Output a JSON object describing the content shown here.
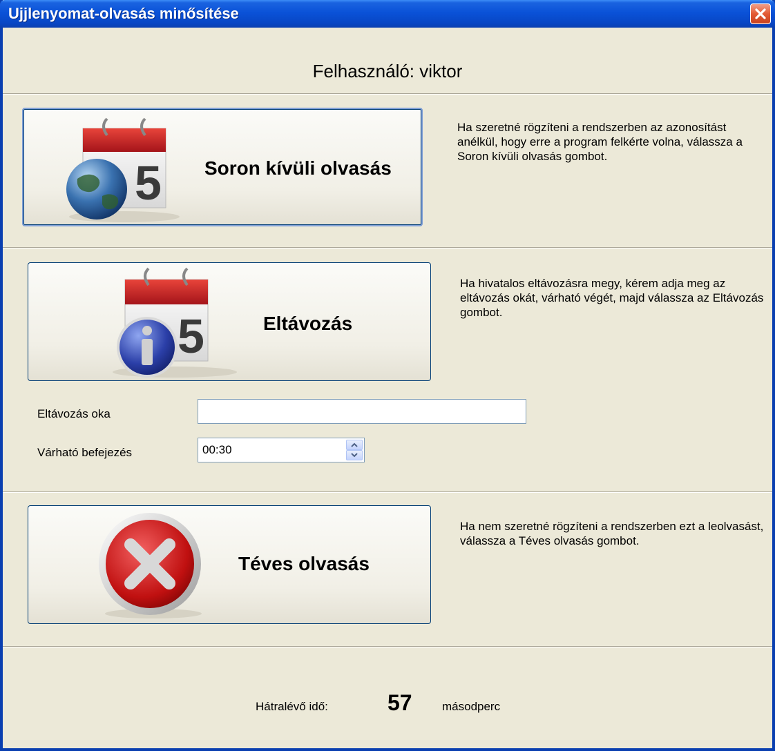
{
  "window": {
    "title": "Ujjlenyomat-olvasás minősítése",
    "close_icon": "close-icon"
  },
  "user_line": "Felhasználó: viktor",
  "out_of_turn": {
    "button_label": "Soron kívüli olvasás",
    "icon": "calendar-globe-icon",
    "description": "Ha szeretné rögzíteni a rendszerben az azonosítást anélkül, hogy erre a program felkérte volna, válassza a Soron kívüli olvasás gombot."
  },
  "departure": {
    "button_label": "Eltávozás",
    "icon": "calendar-info-icon",
    "description": "Ha hivatalos eltávozásra megy, kérem adja meg az eltávozás okát, várható végét, majd válassza az Eltávozás gombot.",
    "reason_label": "Eltávozás oka",
    "reason_value": "",
    "end_label": "Várható befejezés",
    "end_value": "00:30"
  },
  "false_read": {
    "button_label": "Téves olvasás",
    "icon": "red-x-icon",
    "description": "Ha nem szeretné rögzíteni a rendszerben ezt a leolvasást, válassza a Téves olvasás gombot."
  },
  "remaining": {
    "label": "Hátralévő idő:",
    "value": "57",
    "unit": "másodperc"
  },
  "colors": {
    "titlebar": "#0a52d8",
    "window_bg": "#ece9d8",
    "close": "#e35b35"
  }
}
